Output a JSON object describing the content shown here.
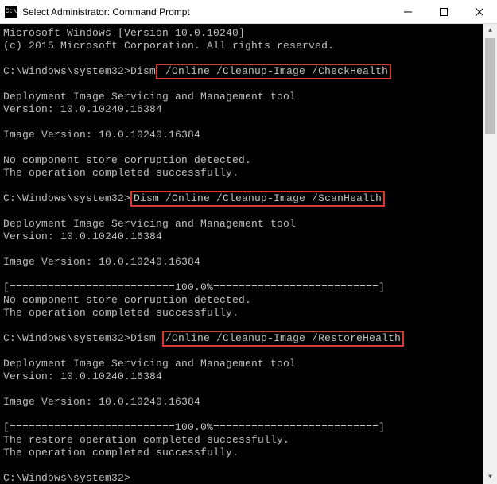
{
  "window": {
    "title": "Select Administrator: Command Prompt"
  },
  "console": {
    "lines": [
      {
        "text": "Microsoft Windows [Version 10.0.10240]"
      },
      {
        "text": "(c) 2015 Microsoft Corporation. All rights reserved."
      },
      {
        "text": ""
      },
      {
        "prompt": "C:\\Windows\\system32>",
        "cmd_pre": "Dism",
        "highlight": " /Online /Cleanup-Image /CheckHealth"
      },
      {
        "text": ""
      },
      {
        "text": "Deployment Image Servicing and Management tool"
      },
      {
        "text": "Version: 10.0.10240.16384"
      },
      {
        "text": ""
      },
      {
        "text": "Image Version: 10.0.10240.16384"
      },
      {
        "text": ""
      },
      {
        "text": "No component store corruption detected."
      },
      {
        "text": "The operation completed successfully."
      },
      {
        "text": ""
      },
      {
        "prompt": "C:\\Windows\\system32>",
        "cmd_pre": "",
        "highlight": "Dism /Online /Cleanup-Image /ScanHealth"
      },
      {
        "text": ""
      },
      {
        "text": "Deployment Image Servicing and Management tool"
      },
      {
        "text": "Version: 10.0.10240.16384"
      },
      {
        "text": ""
      },
      {
        "text": "Image Version: 10.0.10240.16384"
      },
      {
        "text": ""
      },
      {
        "text": "[==========================100.0%==========================]"
      },
      {
        "text": "No component store corruption detected."
      },
      {
        "text": "The operation completed successfully."
      },
      {
        "text": ""
      },
      {
        "prompt": "C:\\Windows\\system32>",
        "cmd_pre": "Dism ",
        "highlight": "/Online /Cleanup-Image /RestoreHealth"
      },
      {
        "text": ""
      },
      {
        "text": "Deployment Image Servicing and Management tool"
      },
      {
        "text": "Version: 10.0.10240.16384"
      },
      {
        "text": ""
      },
      {
        "text": "Image Version: 10.0.10240.16384"
      },
      {
        "text": ""
      },
      {
        "text": "[==========================100.0%==========================]"
      },
      {
        "text": "The restore operation completed successfully."
      },
      {
        "text": "The operation completed successfully."
      },
      {
        "text": ""
      },
      {
        "text": "C:\\Windows\\system32>"
      }
    ]
  }
}
